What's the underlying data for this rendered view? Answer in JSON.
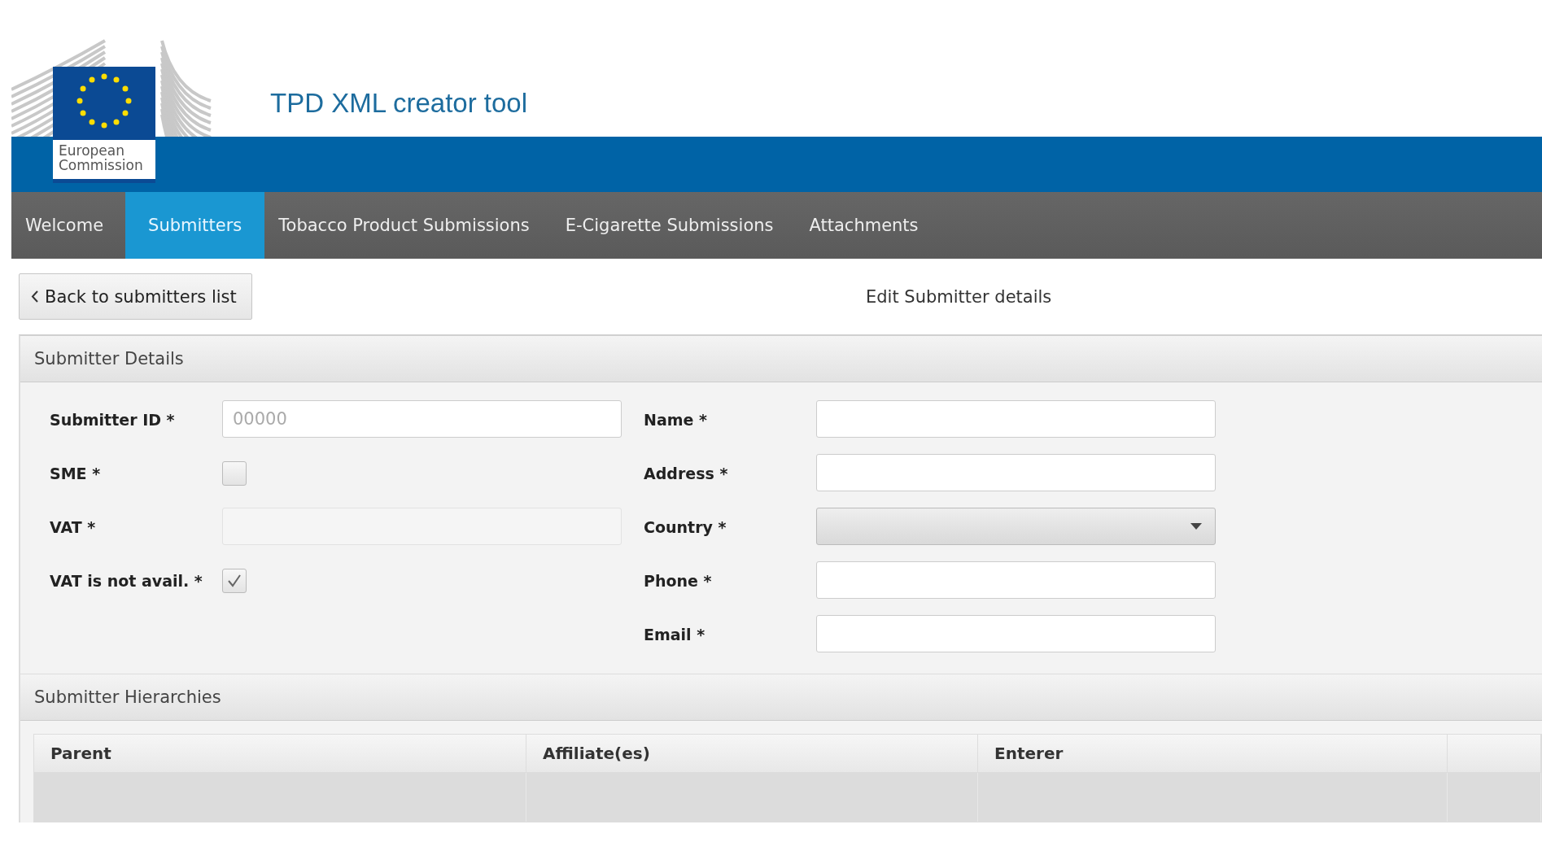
{
  "header": {
    "logo_text": "European Commission",
    "title": "TPD XML creator tool"
  },
  "nav": [
    {
      "label": "Welcome",
      "selected": false
    },
    {
      "label": "Submitters",
      "selected": true
    },
    {
      "label": "Tobacco Product Submissions",
      "selected": false
    },
    {
      "label": "E-Cigarette Submissions",
      "selected": false
    },
    {
      "label": "Attachments",
      "selected": false
    }
  ],
  "toolbar": {
    "back_button": "Back to submitters list",
    "page_title": "Edit Submitter details"
  },
  "details": {
    "title": "Submitter Details",
    "left_fields": [
      {
        "kind": "text",
        "label": "Submitter ID *",
        "placeholder": "00000",
        "disabled": false
      },
      {
        "kind": "checkbox",
        "label": "SME *",
        "checked": false
      },
      {
        "kind": "text",
        "label": "VAT *",
        "disabled": true
      },
      {
        "kind": "checkbox",
        "label": "VAT is not avail. *",
        "checked": true
      }
    ],
    "right_fields": [
      {
        "kind": "text",
        "label": "Name *"
      },
      {
        "kind": "text",
        "label": "Address *"
      },
      {
        "kind": "select",
        "label": "Country *"
      },
      {
        "kind": "text",
        "label": "Phone *"
      },
      {
        "kind": "text",
        "label": "Email *"
      }
    ]
  },
  "hierarchies": {
    "title": "Submitter Hierarchies",
    "columns": [
      "Parent",
      "Affiliate(es)",
      "Enterer"
    ]
  }
}
